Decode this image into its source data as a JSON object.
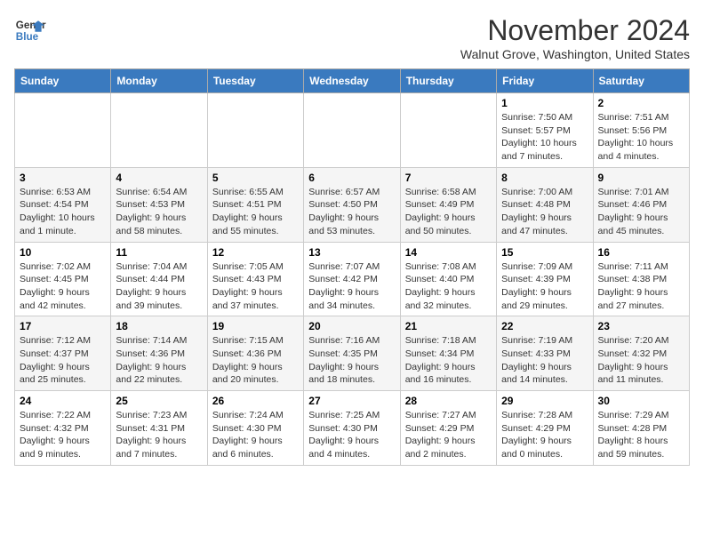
{
  "header": {
    "logo_line1": "General",
    "logo_line2": "Blue",
    "month_year": "November 2024",
    "location": "Walnut Grove, Washington, United States"
  },
  "days_of_week": [
    "Sunday",
    "Monday",
    "Tuesday",
    "Wednesday",
    "Thursday",
    "Friday",
    "Saturday"
  ],
  "weeks": [
    [
      {
        "day": "",
        "info": ""
      },
      {
        "day": "",
        "info": ""
      },
      {
        "day": "",
        "info": ""
      },
      {
        "day": "",
        "info": ""
      },
      {
        "day": "",
        "info": ""
      },
      {
        "day": "1",
        "info": "Sunrise: 7:50 AM\nSunset: 5:57 PM\nDaylight: 10 hours and 7 minutes."
      },
      {
        "day": "2",
        "info": "Sunrise: 7:51 AM\nSunset: 5:56 PM\nDaylight: 10 hours and 4 minutes."
      }
    ],
    [
      {
        "day": "3",
        "info": "Sunrise: 6:53 AM\nSunset: 4:54 PM\nDaylight: 10 hours and 1 minute."
      },
      {
        "day": "4",
        "info": "Sunrise: 6:54 AM\nSunset: 4:53 PM\nDaylight: 9 hours and 58 minutes."
      },
      {
        "day": "5",
        "info": "Sunrise: 6:55 AM\nSunset: 4:51 PM\nDaylight: 9 hours and 55 minutes."
      },
      {
        "day": "6",
        "info": "Sunrise: 6:57 AM\nSunset: 4:50 PM\nDaylight: 9 hours and 53 minutes."
      },
      {
        "day": "7",
        "info": "Sunrise: 6:58 AM\nSunset: 4:49 PM\nDaylight: 9 hours and 50 minutes."
      },
      {
        "day": "8",
        "info": "Sunrise: 7:00 AM\nSunset: 4:48 PM\nDaylight: 9 hours and 47 minutes."
      },
      {
        "day": "9",
        "info": "Sunrise: 7:01 AM\nSunset: 4:46 PM\nDaylight: 9 hours and 45 minutes."
      }
    ],
    [
      {
        "day": "10",
        "info": "Sunrise: 7:02 AM\nSunset: 4:45 PM\nDaylight: 9 hours and 42 minutes."
      },
      {
        "day": "11",
        "info": "Sunrise: 7:04 AM\nSunset: 4:44 PM\nDaylight: 9 hours and 39 minutes."
      },
      {
        "day": "12",
        "info": "Sunrise: 7:05 AM\nSunset: 4:43 PM\nDaylight: 9 hours and 37 minutes."
      },
      {
        "day": "13",
        "info": "Sunrise: 7:07 AM\nSunset: 4:42 PM\nDaylight: 9 hours and 34 minutes."
      },
      {
        "day": "14",
        "info": "Sunrise: 7:08 AM\nSunset: 4:40 PM\nDaylight: 9 hours and 32 minutes."
      },
      {
        "day": "15",
        "info": "Sunrise: 7:09 AM\nSunset: 4:39 PM\nDaylight: 9 hours and 29 minutes."
      },
      {
        "day": "16",
        "info": "Sunrise: 7:11 AM\nSunset: 4:38 PM\nDaylight: 9 hours and 27 minutes."
      }
    ],
    [
      {
        "day": "17",
        "info": "Sunrise: 7:12 AM\nSunset: 4:37 PM\nDaylight: 9 hours and 25 minutes."
      },
      {
        "day": "18",
        "info": "Sunrise: 7:14 AM\nSunset: 4:36 PM\nDaylight: 9 hours and 22 minutes."
      },
      {
        "day": "19",
        "info": "Sunrise: 7:15 AM\nSunset: 4:36 PM\nDaylight: 9 hours and 20 minutes."
      },
      {
        "day": "20",
        "info": "Sunrise: 7:16 AM\nSunset: 4:35 PM\nDaylight: 9 hours and 18 minutes."
      },
      {
        "day": "21",
        "info": "Sunrise: 7:18 AM\nSunset: 4:34 PM\nDaylight: 9 hours and 16 minutes."
      },
      {
        "day": "22",
        "info": "Sunrise: 7:19 AM\nSunset: 4:33 PM\nDaylight: 9 hours and 14 minutes."
      },
      {
        "day": "23",
        "info": "Sunrise: 7:20 AM\nSunset: 4:32 PM\nDaylight: 9 hours and 11 minutes."
      }
    ],
    [
      {
        "day": "24",
        "info": "Sunrise: 7:22 AM\nSunset: 4:32 PM\nDaylight: 9 hours and 9 minutes."
      },
      {
        "day": "25",
        "info": "Sunrise: 7:23 AM\nSunset: 4:31 PM\nDaylight: 9 hours and 7 minutes."
      },
      {
        "day": "26",
        "info": "Sunrise: 7:24 AM\nSunset: 4:30 PM\nDaylight: 9 hours and 6 minutes."
      },
      {
        "day": "27",
        "info": "Sunrise: 7:25 AM\nSunset: 4:30 PM\nDaylight: 9 hours and 4 minutes."
      },
      {
        "day": "28",
        "info": "Sunrise: 7:27 AM\nSunset: 4:29 PM\nDaylight: 9 hours and 2 minutes."
      },
      {
        "day": "29",
        "info": "Sunrise: 7:28 AM\nSunset: 4:29 PM\nDaylight: 9 hours and 0 minutes."
      },
      {
        "day": "30",
        "info": "Sunrise: 7:29 AM\nSunset: 4:28 PM\nDaylight: 8 hours and 59 minutes."
      }
    ]
  ]
}
